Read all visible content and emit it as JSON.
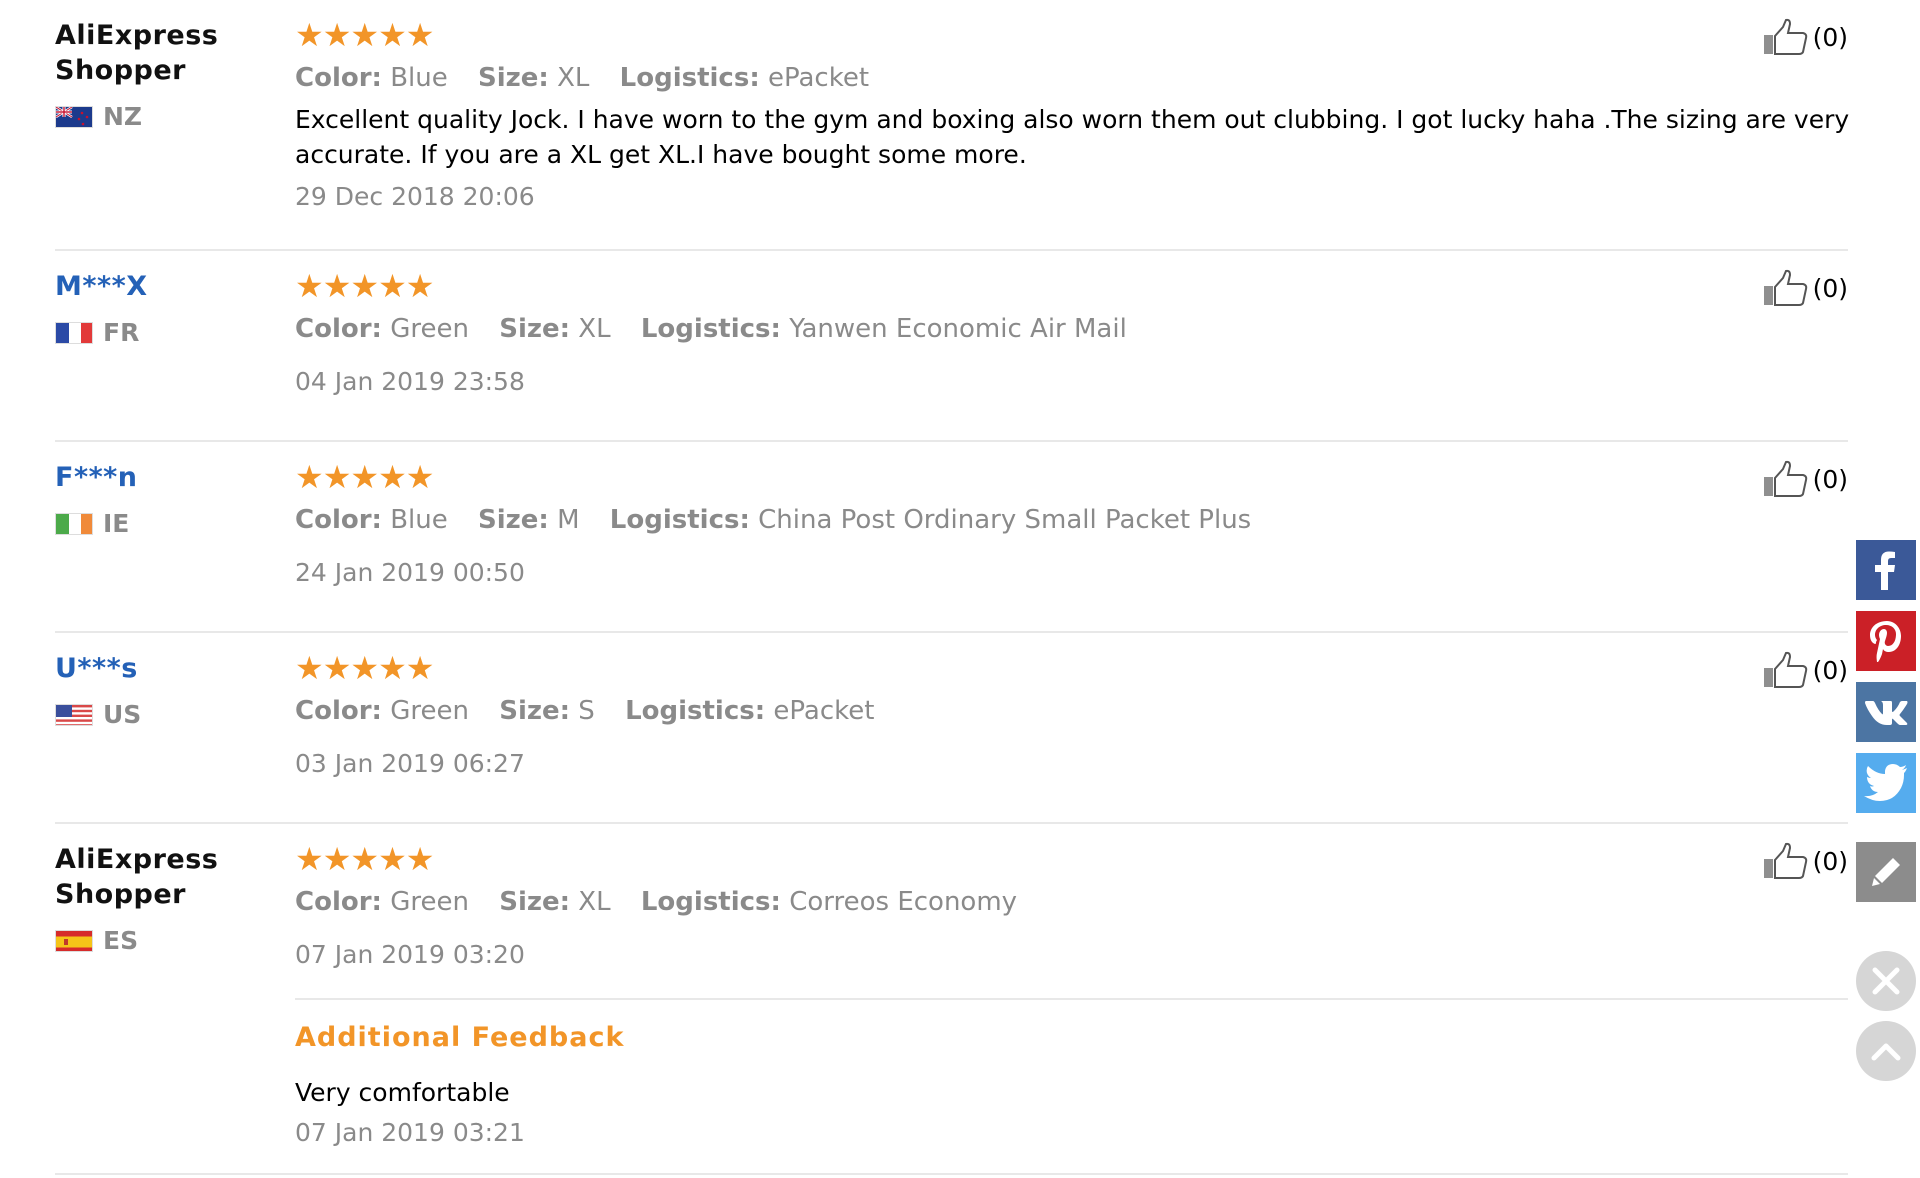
{
  "colors": {
    "star": "#f29528",
    "masked_name": "#2461b7",
    "grey_text": "#8a8a8a",
    "facebook": "#3b5998",
    "pinterest": "#cb2027",
    "vk": "#4c75a3",
    "twitter": "#55acee",
    "edit": "#8c8c8c"
  },
  "labels": {
    "color": "Color:",
    "size": "Size:",
    "logistics": "Logistics:",
    "like_count": "(0)",
    "stars": "★★★★★"
  },
  "reviews": [
    {
      "user_line1": "AliExpress",
      "user_line2": "Shopper",
      "country": "NZ",
      "flag_icon": "nz-flag-icon",
      "rating": 5,
      "color": "Blue",
      "size": "XL",
      "logistics": "ePacket",
      "text": "Excellent quality Jock. I have worn to the gym and boxing also worn them out clubbing. I got lucky haha .The sizing are very accurate. If you are a XL get XL.I have bought some more.",
      "date": "29 Dec 2018 20:06"
    },
    {
      "user": "M***X",
      "country": "FR",
      "flag_icon": "fr-flag-icon",
      "rating": 5,
      "color": "Green",
      "size": "XL",
      "logistics": "Yanwen Economic Air Mail",
      "date": "04 Jan 2019 23:58"
    },
    {
      "user": "F***n",
      "country": "IE",
      "flag_icon": "ie-flag-icon",
      "rating": 5,
      "color": "Blue",
      "size": "M",
      "logistics": "China Post Ordinary Small Packet Plus",
      "date": "24 Jan 2019 00:50"
    },
    {
      "user": "U***s",
      "country": "US",
      "flag_icon": "us-flag-icon",
      "rating": 5,
      "color": "Green",
      "size": "S",
      "logistics": "ePacket",
      "date": "03 Jan 2019 06:27"
    },
    {
      "user_line1": "AliExpress",
      "user_line2": "Shopper",
      "country": "ES",
      "flag_icon": "es-flag-icon",
      "rating": 5,
      "color": "Green",
      "size": "XL",
      "logistics": "Correos Economy",
      "date": "07 Jan 2019 03:20",
      "additional_title": "Additional Feedback",
      "additional_text": "Very comfortable",
      "additional_date": "07 Jan 2019 03:21"
    }
  ],
  "sidebar": [
    "facebook-icon",
    "pinterest-icon",
    "vk-icon",
    "twitter-icon",
    "edit-icon",
    "close-icon",
    "chevron-up-icon"
  ]
}
